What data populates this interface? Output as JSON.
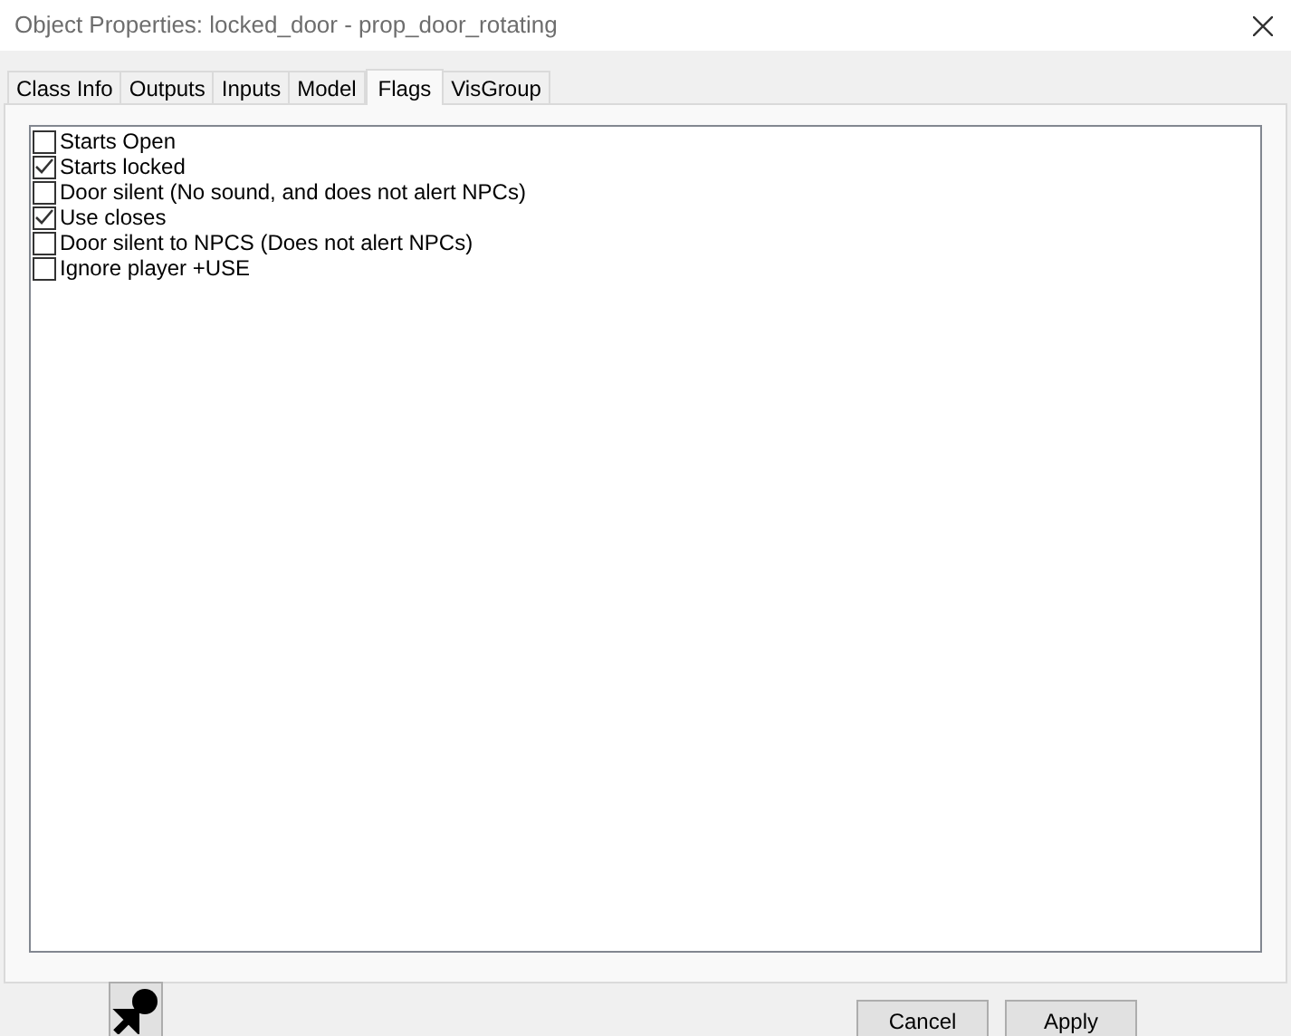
{
  "window": {
    "title": "Object Properties: locked_door - prop_door_rotating"
  },
  "tabs": [
    {
      "label": "Class Info",
      "selected": false
    },
    {
      "label": "Outputs",
      "selected": false
    },
    {
      "label": "Inputs",
      "selected": false
    },
    {
      "label": "Model",
      "selected": false
    },
    {
      "label": "Flags",
      "selected": true
    },
    {
      "label": "VisGroup",
      "selected": false
    }
  ],
  "flags": [
    {
      "label": "Starts Open",
      "checked": false
    },
    {
      "label": "Starts locked",
      "checked": true
    },
    {
      "label": "Door silent (No sound, and does not alert NPCs)",
      "checked": false
    },
    {
      "label": "Use closes",
      "checked": true
    },
    {
      "label": "Door silent to NPCS (Does not alert NPCs)",
      "checked": false
    },
    {
      "label": "Ignore player +USE",
      "checked": false
    }
  ],
  "buttons": [
    "Cancel",
    "Apply"
  ]
}
